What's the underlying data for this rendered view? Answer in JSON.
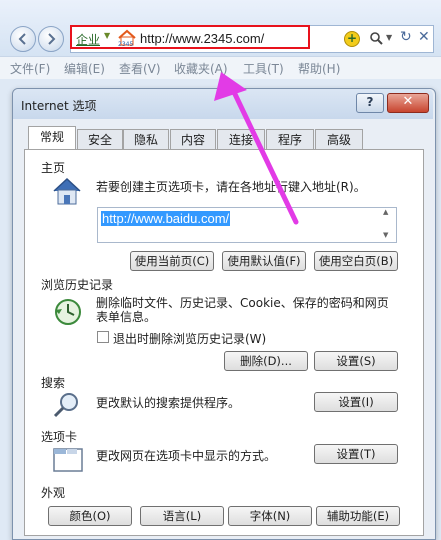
{
  "browser": {
    "address_prefix": "企业",
    "brand": "2345",
    "url": "http://www.2345.com/",
    "menus": [
      "文件(F)",
      "编辑(E)",
      "查看(V)",
      "收藏夹(A)",
      "工具(T)",
      "帮助(H)"
    ]
  },
  "dialog": {
    "title": "Internet 选项",
    "help_button": "?",
    "tabs": [
      "常规",
      "安全",
      "隐私",
      "内容",
      "连接",
      "程序",
      "高级"
    ],
    "homepage": {
      "heading": "主页",
      "description": "若要创建主页选项卡，请在各地址行键入地址(R)。",
      "url_value": "http://www.baidu.com/",
      "btn_current": "使用当前页(C)",
      "btn_default": "使用默认值(F)",
      "btn_blank": "使用空白页(B)"
    },
    "history": {
      "heading": "浏览历史记录",
      "description_line1": "删除临时文件、历史记录、Cookie、保存的密码和网页",
      "description_line2": "表单信息。",
      "checkbox_label": "退出时删除浏览历史记录(W)",
      "btn_delete": "删除(D)...",
      "btn_settings": "设置(S)"
    },
    "search": {
      "heading": "搜索",
      "description": "更改默认的搜索提供程序。",
      "btn_settings": "设置(I)"
    },
    "tabs_section": {
      "heading": "选项卡",
      "description": "更改网页在选项卡中显示的方式。",
      "btn_settings": "设置(T)"
    },
    "appearance": {
      "heading": "外观",
      "btn_colors": "颜色(O)",
      "btn_languages": "语言(L)",
      "btn_fonts": "字体(N)",
      "btn_accessibility": "辅助功能(E)"
    }
  },
  "colors": {
    "highlight_border": "#e8121c",
    "arrow": "#e23be6",
    "selection": "#3399ff"
  }
}
